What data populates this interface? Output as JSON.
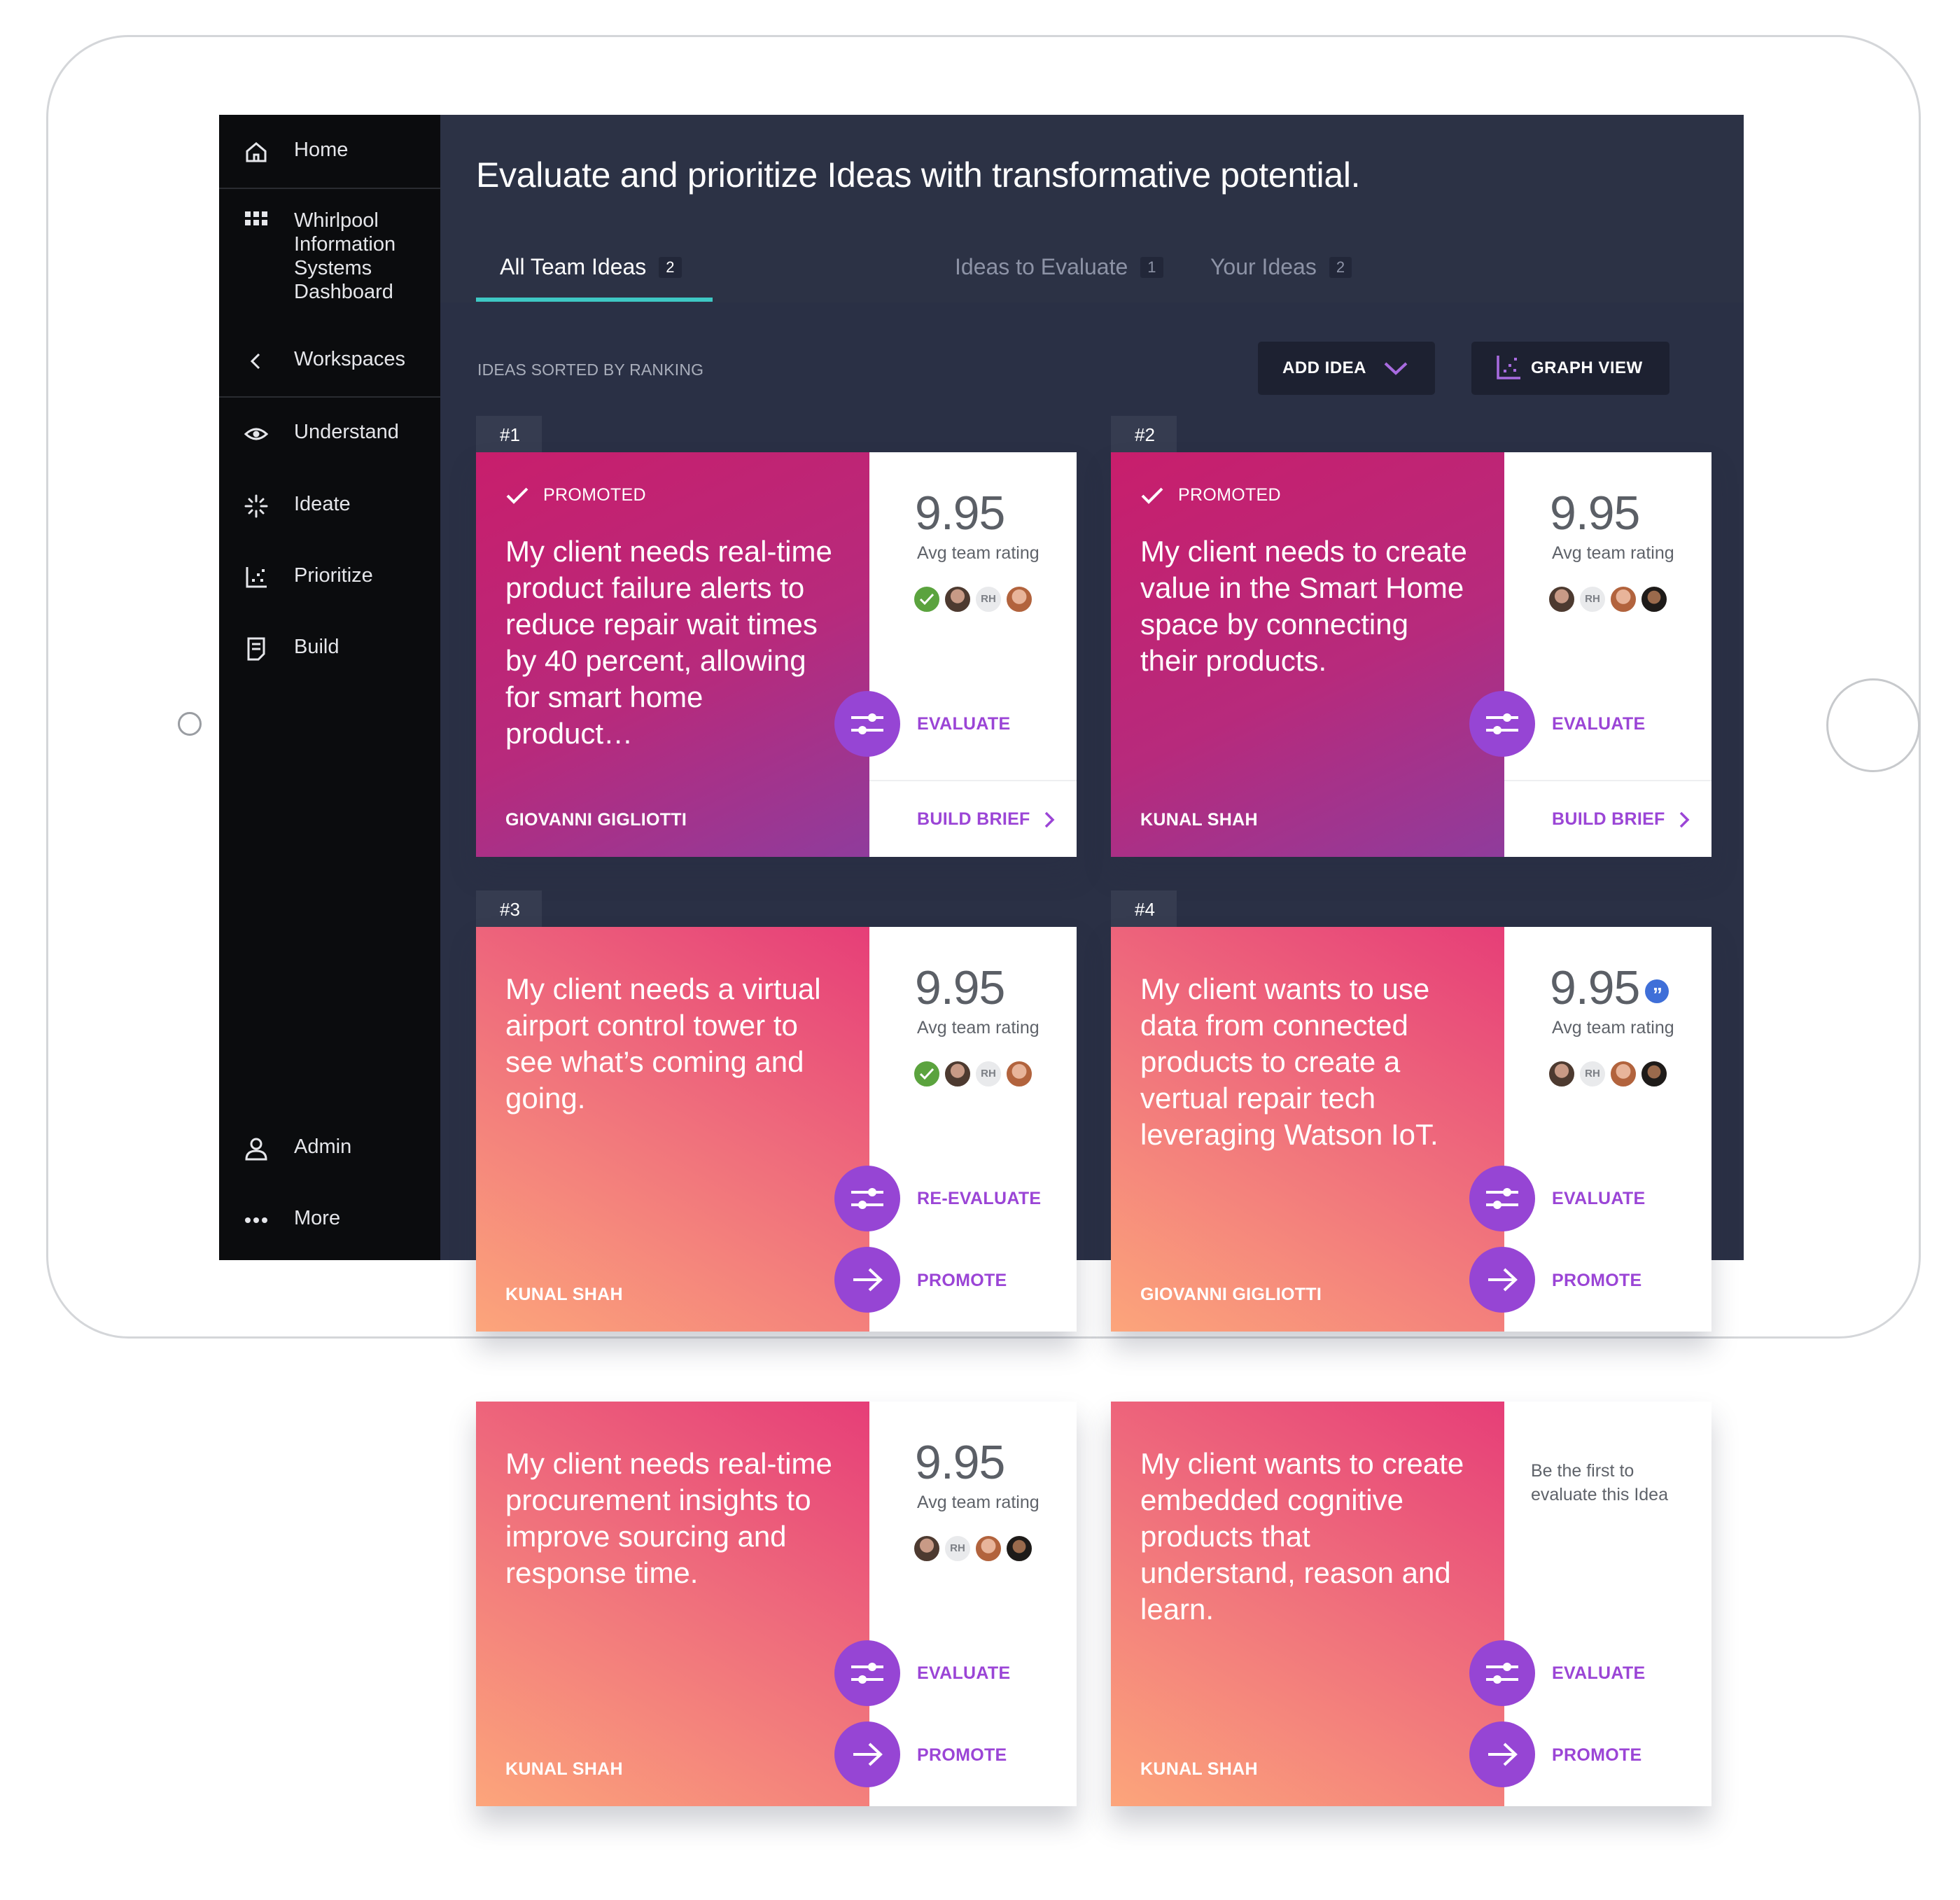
{
  "sidebar": {
    "items": [
      {
        "label": "Home",
        "icon": "home-icon"
      },
      {
        "label": "Whirlpool Information Systems Dashboard",
        "icon": "grid-icon"
      },
      {
        "label": "Workspaces",
        "icon": "chevron-left-icon"
      },
      {
        "label": "Understand",
        "icon": "eye-icon"
      },
      {
        "label": "Ideate",
        "icon": "sparkle-icon"
      },
      {
        "label": "Prioritize",
        "icon": "scatter-icon"
      },
      {
        "label": "Build",
        "icon": "document-icon"
      },
      {
        "label": "Admin",
        "icon": "user-icon"
      },
      {
        "label": "More",
        "icon": "more-icon"
      }
    ]
  },
  "header": {
    "title": "Evaluate and prioritize Ideas with transformative potential.",
    "tabs": [
      {
        "label": "All Team Ideas",
        "count": "2"
      },
      {
        "label": "Ideas to Evaluate",
        "count": "1"
      },
      {
        "label": "Your Ideas",
        "count": "2"
      }
    ]
  },
  "toolbar": {
    "sorted_label": "IDEAS SORTED BY RANKING",
    "add_idea_label": "ADD IDEA",
    "graph_view_label": "GRAPH VIEW"
  },
  "colors": {
    "accent": "#9645d4",
    "tab_underline": "#3ec8c4",
    "sidebar_bg": "#0b0c0e",
    "main_bg": "#2a3045"
  },
  "ideas": [
    {
      "rank": "#1",
      "promoted_label": "PROMOTED",
      "text": "My client needs real-time product failure alerts to reduce repair wait times by 40 percent, allowing for smart home product…",
      "author": "GIOVANNI GIGLIOTTI",
      "score": "9.95",
      "rating_label": "Avg team rating",
      "actions": [
        "EVALUATE",
        "BUILD BRIEF"
      ],
      "avatar_initials": "RH"
    },
    {
      "rank": "#2",
      "promoted_label": "PROMOTED",
      "text": "My client needs to create value in the Smart Home space by connecting their products.",
      "author": "KUNAL SHAH",
      "score": "9.95",
      "rating_label": "Avg team rating",
      "actions": [
        "EVALUATE",
        "BUILD BRIEF"
      ],
      "avatar_initials": "RH"
    },
    {
      "rank": "#3",
      "text": "My client needs a virtual airport control tower to see what’s coming and going.",
      "author": "KUNAL SHAH",
      "score": "9.95",
      "rating_label": "Avg team rating",
      "actions": [
        "RE-EVALUATE",
        "PROMOTE"
      ],
      "avatar_initials": "RH"
    },
    {
      "rank": "#4",
      "text": "My client wants to use data from connected products to create a vertual repair tech leveraging Watson IoT.",
      "author": "GIOVANNI GIGLIOTTI",
      "score": "9.95",
      "rating_label": "Avg team rating",
      "actions": [
        "EVALUATE",
        "PROMOTE"
      ],
      "avatar_initials": "RH"
    },
    {
      "text": "My client needs real-time procurement insights to improve sourcing and response time.",
      "author": "KUNAL SHAH",
      "score": "9.95",
      "rating_label": "Avg team rating",
      "actions": [
        "EVALUATE",
        "PROMOTE"
      ],
      "avatar_initials": "RH"
    },
    {
      "text": "My client wants to create embedded cognitive products that understand, reason and learn.",
      "author": "KUNAL SHAH",
      "empty_rating_text": "Be the first to evaluate this Idea",
      "actions": [
        "EVALUATE",
        "PROMOTE"
      ]
    }
  ]
}
